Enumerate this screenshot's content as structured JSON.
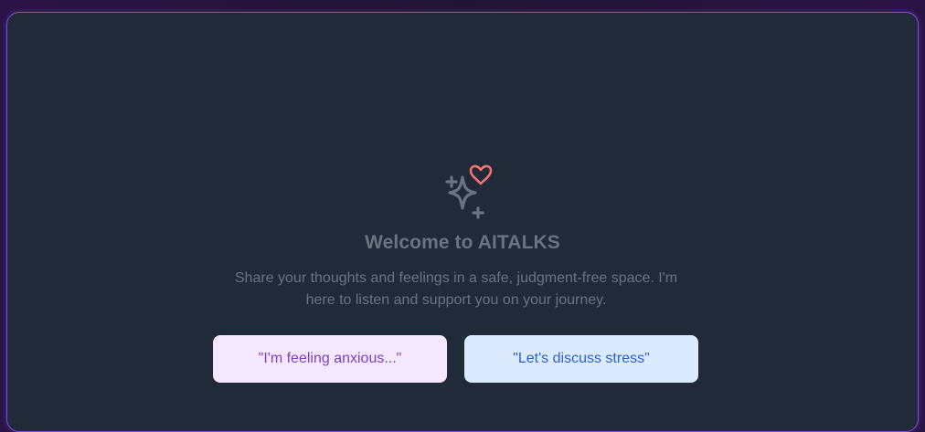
{
  "welcome": {
    "title": "Welcome to AITALKS",
    "subtitle": "Share your thoughts and feelings in a safe, judgment-free space. I'm here to listen and support you on your journey.",
    "icon": "sparkles-heart-icon"
  },
  "suggestions": [
    {
      "label": "\"I'm feeling anxious...\""
    },
    {
      "label": "\"Let's discuss stress\""
    }
  ],
  "colors": {
    "heart": "#f87171",
    "sparkles": "#6b7280",
    "chip_purple_bg": "#f3e8ff",
    "chip_blue_bg": "#dbeafe",
    "frame_border": "#7c4dd6"
  }
}
